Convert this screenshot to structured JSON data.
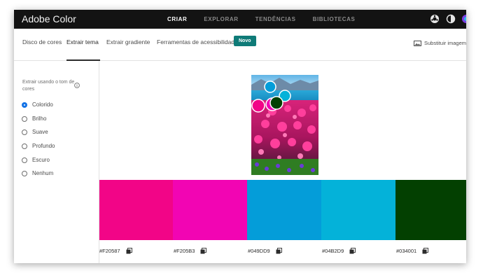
{
  "app": {
    "title": "Adobe Color"
  },
  "topnav": [
    {
      "label": "CRIAR",
      "active": true
    },
    {
      "label": "EXPLORAR",
      "active": false
    },
    {
      "label": "TENDÊNCIAS",
      "active": false
    },
    {
      "label": "BIBLIOTECAS",
      "active": false
    }
  ],
  "tabs": [
    {
      "label": "Disco de cores"
    },
    {
      "label": "Extrair tema"
    },
    {
      "label": "Extrair gradiente"
    },
    {
      "label": "Ferramentas de acessibilidade"
    }
  ],
  "badge": {
    "label": "Novo"
  },
  "replace_image": {
    "label": "Substituir imagem"
  },
  "mood": {
    "label": "Extrair usando o tom de cores",
    "options": [
      {
        "label": "Colorido",
        "checked": true
      },
      {
        "label": "Brilho",
        "checked": false
      },
      {
        "label": "Suave",
        "checked": false
      },
      {
        "label": "Profundo",
        "checked": false
      },
      {
        "label": "Escuro",
        "checked": false
      },
      {
        "label": "Nenhum",
        "checked": false
      }
    ]
  },
  "palette": [
    {
      "hex": "#F20587",
      "color": "#f20587"
    },
    {
      "hex": "#F205B3",
      "color": "#f205b3"
    },
    {
      "hex": "#049DD9",
      "color": "#049dd9"
    },
    {
      "hex": "#04B2D9",
      "color": "#04b2d9"
    },
    {
      "hex": "#034001",
      "color": "#034001"
    }
  ]
}
